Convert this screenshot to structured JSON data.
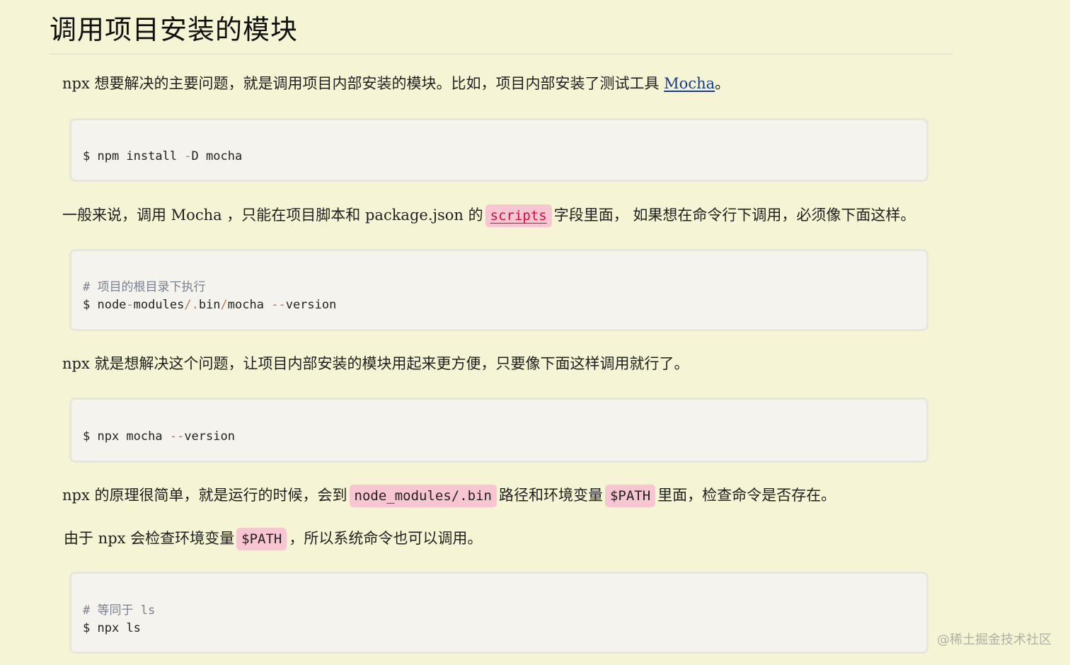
{
  "heading": "调用项目安装的模块",
  "p1": {
    "text": "npx 想要解决的主要问题，就是调用项目内部安装的模块。比如，项目内部安装了测试工具 ",
    "link": "Mocha",
    "suffix": "。"
  },
  "code1": {
    "prompt": "$ npm install ",
    "flag": "-",
    "rest": "D mocha"
  },
  "p2": {
    "text": "一般来说，调用 Mocha ，只能在项目脚本和 package.json 的",
    "code": "scripts",
    "suffix": "字段里面， 如果想在命令行下调用，必须像下面这样。"
  },
  "code2": {
    "comment": "# 项目的根目录下执行",
    "line_a": "$ node",
    "dash": "-",
    "line_b": "modules",
    "slash1": "/",
    "dot": ".",
    "line_c": "bin",
    "slash2": "/",
    "line_d": "mocha ",
    "ddash": "--",
    "line_e": "version"
  },
  "p3": {
    "text": "npx 就是想解决这个问题，让项目内部安装的模块用起来更方便，只要像下面这样调用就行了。"
  },
  "code3": {
    "line_a": "$ npx mocha ",
    "ddash": "--",
    "line_b": "version"
  },
  "p4": {
    "text": "npx 的原理很简单，就是运行的时候，会到",
    "code1": "node_modules/.bin",
    "mid": "路径和环境变量",
    "code2": "$PATH",
    "suffix": "里面，检查命令是否存在。"
  },
  "p5": {
    "text": "由于 npx 会检查环境变量",
    "code": "$PATH",
    "suffix": "，所以系统命令也可以调用。"
  },
  "code4": {
    "comment": "# 等同于 ls",
    "line": "$ npx ls"
  },
  "watermark": "@稀土掘金技术社区"
}
